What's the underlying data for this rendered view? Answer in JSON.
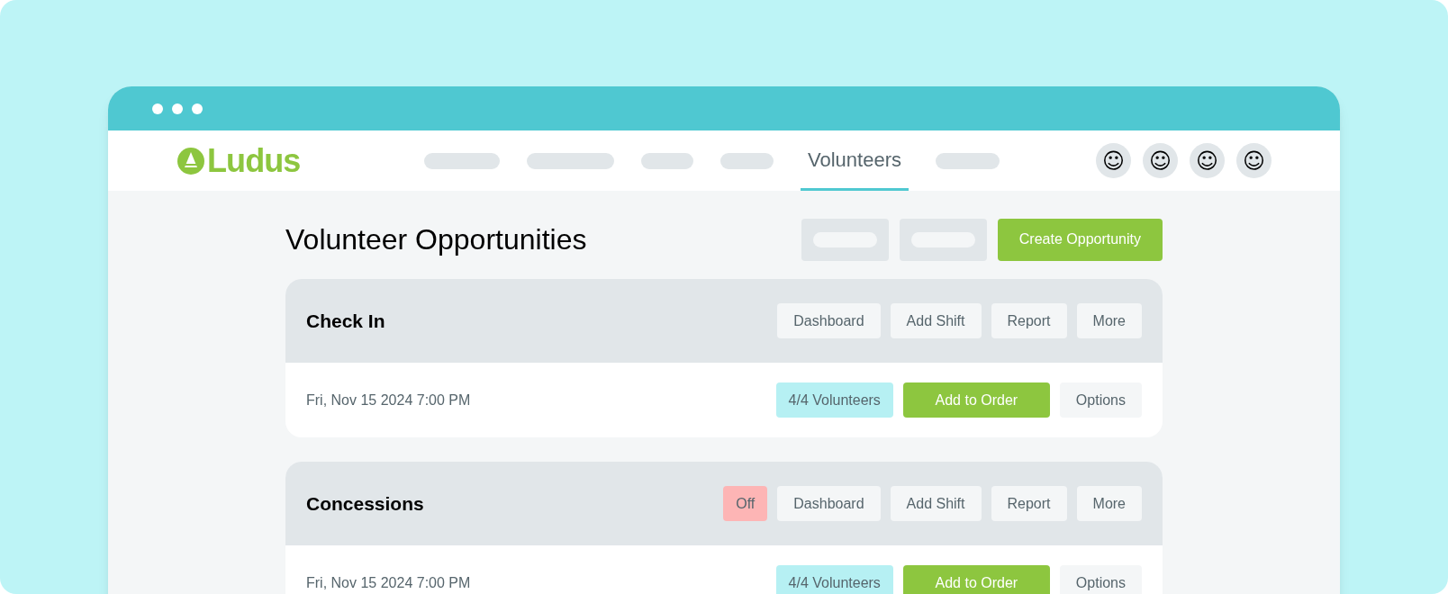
{
  "logo": {
    "text": "Ludus"
  },
  "nav": [
    {
      "kind": "placeholder",
      "selected": false
    },
    {
      "kind": "placeholder",
      "selected": false
    },
    {
      "kind": "placeholder",
      "selected": false
    },
    {
      "kind": "placeholder",
      "selected": false
    },
    {
      "kind": "tab",
      "label": "Volunteers",
      "selected": true
    },
    {
      "kind": "placeholder",
      "selected": false
    }
  ],
  "avatars": [
    "☺",
    "☺",
    "☺",
    "☺"
  ],
  "page_title": "Volunteer Opportunities",
  "header_buttons": [
    {
      "kind": "placeholder"
    },
    {
      "kind": "placeholder"
    },
    {
      "kind": "primary",
      "label": "Create Opportunity"
    }
  ],
  "opportunities": [
    {
      "title": "Check In",
      "off": false,
      "actions": [
        "Dashboard",
        "Add Shift",
        "Report",
        "More"
      ],
      "shifts": [
        {
          "date": "Fri, Nov 15 2024 7:00 PM",
          "volunteers": "4/4 Volunteers",
          "add": "Add to Order",
          "options": "Options"
        }
      ]
    },
    {
      "title": "Concessions",
      "off": true,
      "off_label": "Off",
      "actions": [
        "Dashboard",
        "Add Shift",
        "Report",
        "More"
      ],
      "shifts": [
        {
          "date": "Fri, Nov 15 2024 7:00 PM",
          "volunteers": "4/4 Volunteers",
          "add": "Add to Order",
          "options": "Options"
        }
      ]
    }
  ]
}
